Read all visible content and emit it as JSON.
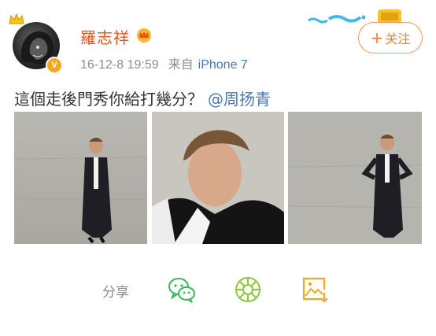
{
  "post": {
    "author": "羅志祥",
    "timestamp": "16-12-8 19:59",
    "source_prefix": "来自",
    "device": "iPhone 7",
    "follow_label": "关注",
    "follow_plus": "+",
    "text": "這個走後門秀你給打幾分？",
    "mention": "@周扬青",
    "verified_badge": "V"
  },
  "photos": [
    {
      "name": "photo-1",
      "desc": "full-length standing photo"
    },
    {
      "name": "photo-2",
      "desc": "close-up portrait"
    },
    {
      "name": "photo-3",
      "desc": "full-length pose hands on hips"
    }
  ],
  "share": {
    "label": "分享",
    "items": [
      {
        "icon": "wechat-icon"
      },
      {
        "icon": "moments-icon"
      },
      {
        "icon": "save-image-icon"
      }
    ]
  },
  "colors": {
    "username": "#e8541e",
    "link": "#4a78b0",
    "follow": "#f07f32",
    "share_green": "#3cb55a",
    "moments_green": "#8cc63f",
    "save_orange": "#f5a623"
  }
}
